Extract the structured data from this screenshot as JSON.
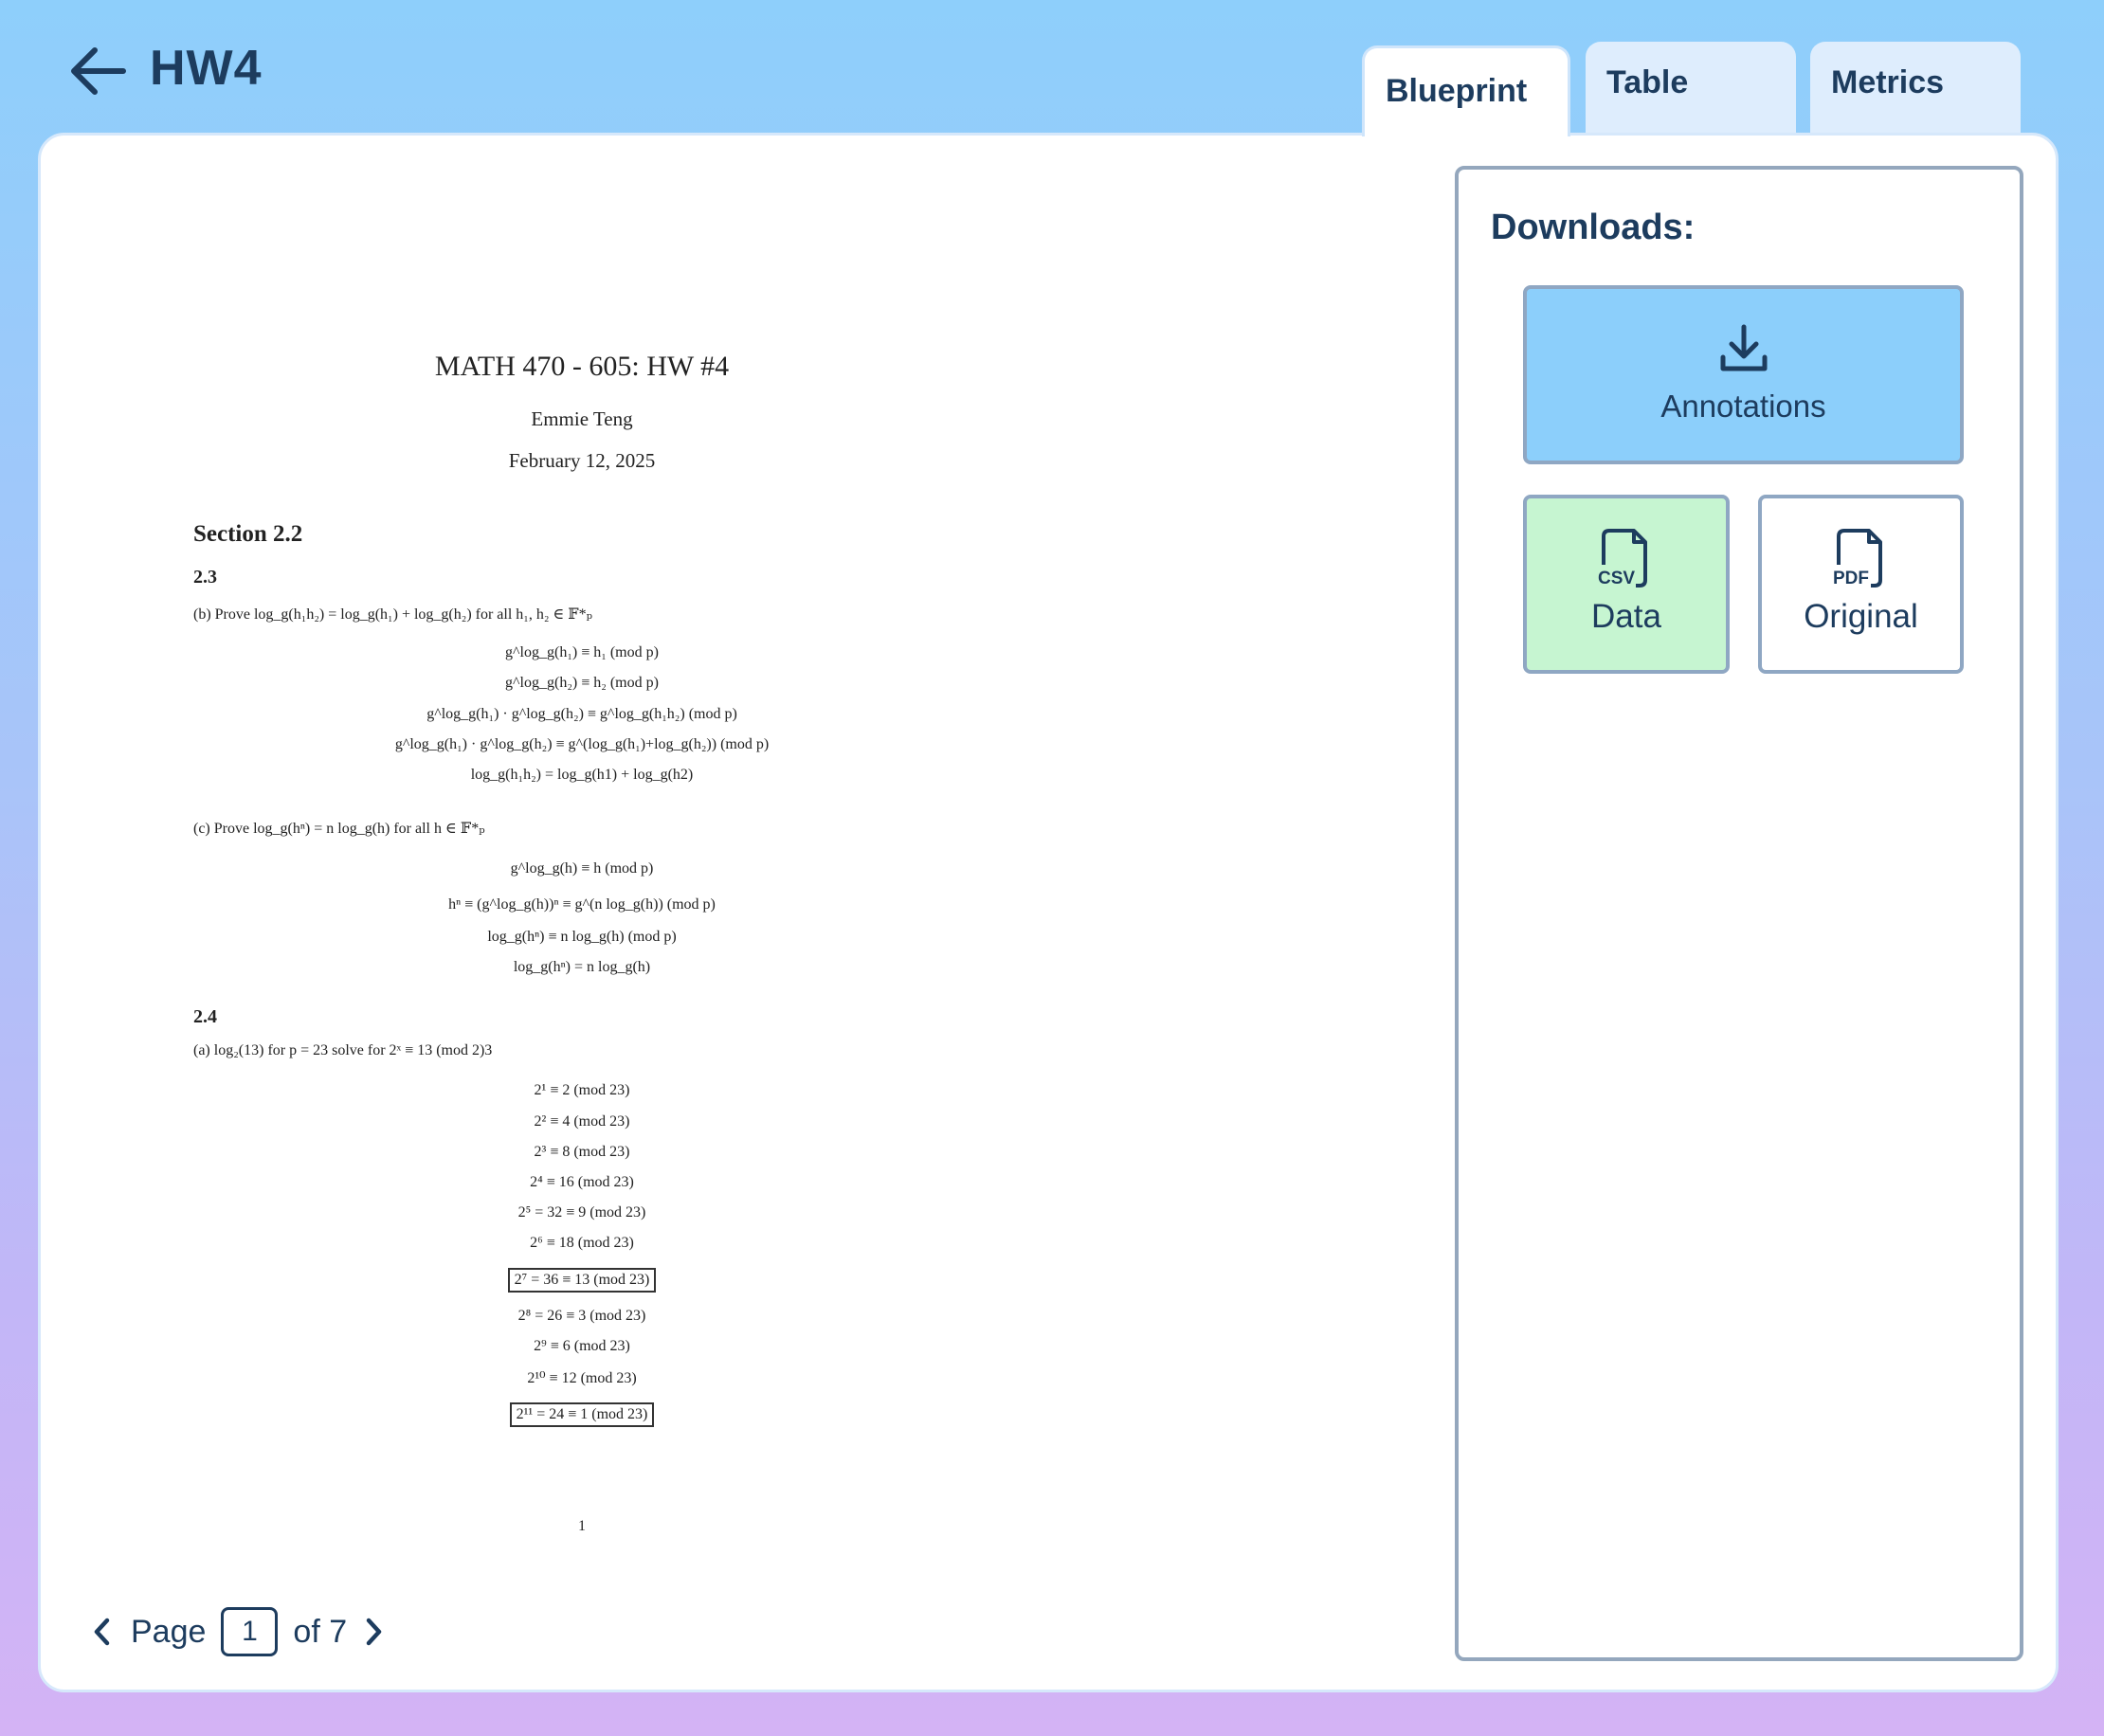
{
  "header": {
    "title": "HW4",
    "back_icon": "arrow-left-icon"
  },
  "tabs": [
    {
      "label": "Blueprint",
      "active": true
    },
    {
      "label": "Table",
      "active": false
    },
    {
      "label": "Metrics",
      "active": false
    }
  ],
  "document": {
    "title": "MATH 470 - 605: HW #4",
    "author": "Emmie Teng",
    "date": "February 12, 2025",
    "section": "Section 2.2",
    "sub_2_3": "2.3",
    "prob_b": "(b) Prove log_g(h₁h₂) = log_g(h₁) + log_g(h₂) for all h₁, h₂ ∈ 𝔽*ₚ",
    "eqs_b": [
      "g^log_g(h₁) ≡ h₁   (mod p)",
      "g^log_g(h₂) ≡ h₂   (mod p)",
      "g^log_g(h₁) · g^log_g(h₂) ≡ g^log_g(h₁h₂)   (mod p)",
      "g^log_g(h₁) · g^log_g(h₂) ≡ g^(log_g(h₁)+log_g(h₂))   (mod p)",
      "log_g(h₁h₂) = log_g(h1) + log_g(h2)"
    ],
    "prob_c": "(c) Prove log_g(hⁿ) = n log_g(h) for all h ∈ 𝔽*ₚ",
    "eqs_c": [
      "g^log_g(h) ≡ h   (mod p)",
      "hⁿ ≡ (g^log_g(h))ⁿ ≡ g^(n log_g(h))   (mod p)",
      "log_g(hⁿ) ≡ n log_g(h)   (mod p)",
      "log_g(hⁿ) = n log_g(h)"
    ],
    "sub_2_4": "2.4",
    "prob_a": "(a) log₂(13) for p = 23 solve for 2ˣ ≡ 13 (mod 2)3",
    "eqs_a": [
      "2¹ ≡ 2   (mod 23)",
      "2² ≡ 4   (mod 23)",
      "2³ ≡ 8   (mod 23)",
      "2⁴ ≡ 16   (mod 23)",
      "2⁵ = 32 ≡ 9   (mod 23)",
      "2⁶ ≡ 18   (mod 23)",
      "2⁷ = 36 ≡ 13   (mod 23)",
      "2⁸ = 26 ≡ 3   (mod 23)",
      "2⁹ ≡ 6   (mod 23)",
      "2¹⁰ ≡ 12   (mod 23)",
      "2¹¹ = 24 ≡ 1   (mod 23)"
    ],
    "page_number": "1"
  },
  "pager": {
    "label": "Page",
    "current": "1",
    "of_text": "of 7"
  },
  "downloads": {
    "title": "Downloads:",
    "annotations": {
      "label": "Annotations",
      "icon": "download-icon"
    },
    "data": {
      "label": "Data",
      "badge": "CSV",
      "icon": "csv-file-icon"
    },
    "original": {
      "label": "Original",
      "badge": "PDF",
      "icon": "pdf-file-icon"
    }
  },
  "colors": {
    "accent": "#8ccffb",
    "text": "#1d3c5e",
    "data_button": "#c6f5d1"
  }
}
